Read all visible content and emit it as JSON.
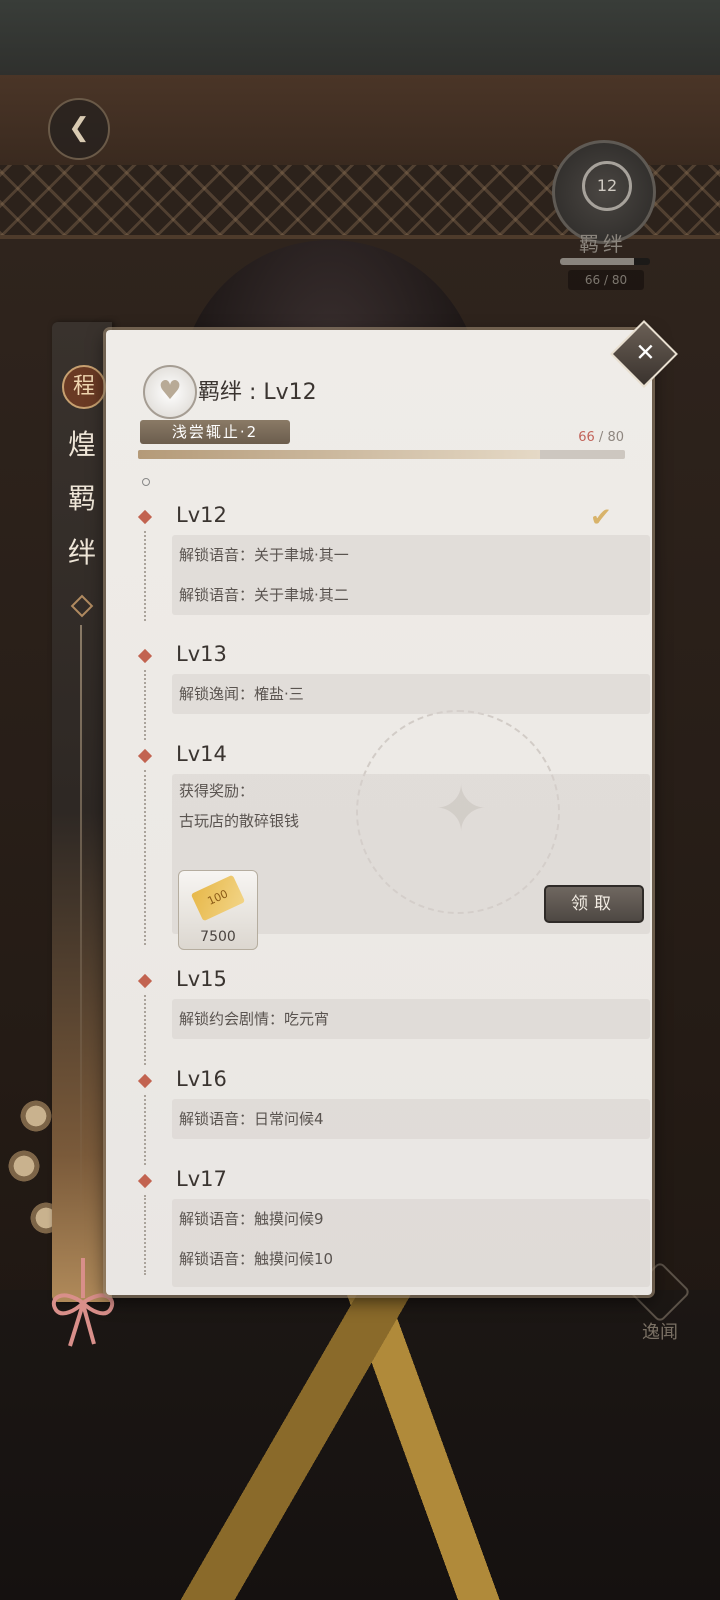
{
  "header": {
    "bond_label": "羁绊 : Lv12",
    "tag": "浅尝辄止·2",
    "progress_current": "66",
    "progress_sep": "/",
    "progress_max": "80",
    "progress_fraction": 0.825
  },
  "side_strip": {
    "seal": "程",
    "title_chars": [
      "煌",
      "羁",
      "绊"
    ]
  },
  "bond_badge": {
    "level": "12",
    "label": "羁绊",
    "count": "66 / 80"
  },
  "side_menu": {
    "plot": "逸闻"
  },
  "levels": [
    {
      "title": "Lv12",
      "rows": [
        "解锁语音：关于聿城·其一",
        "解锁语音：关于聿城·其二"
      ],
      "completed": true
    },
    {
      "title": "Lv13",
      "rows": [
        "解锁逸闻：榷盐·三"
      ]
    },
    {
      "title": "Lv14",
      "rows": [
        "获得奖励：",
        "古玩店的散碎银钱"
      ],
      "reward_qty": "7500",
      "claim_label": "领取"
    },
    {
      "title": "Lv15",
      "rows": [
        "解锁约会剧情：吃元宵"
      ]
    },
    {
      "title": "Lv16",
      "rows": [
        "解锁语音：日常问候4"
      ]
    },
    {
      "title": "Lv17",
      "rows": [
        "解锁语音：触摸问候9",
        "解锁语音：触摸问候10"
      ]
    }
  ],
  "colors": {
    "accent": "#c26350",
    "panel": "#efece8",
    "progress_fill": "#e5d9c6"
  }
}
